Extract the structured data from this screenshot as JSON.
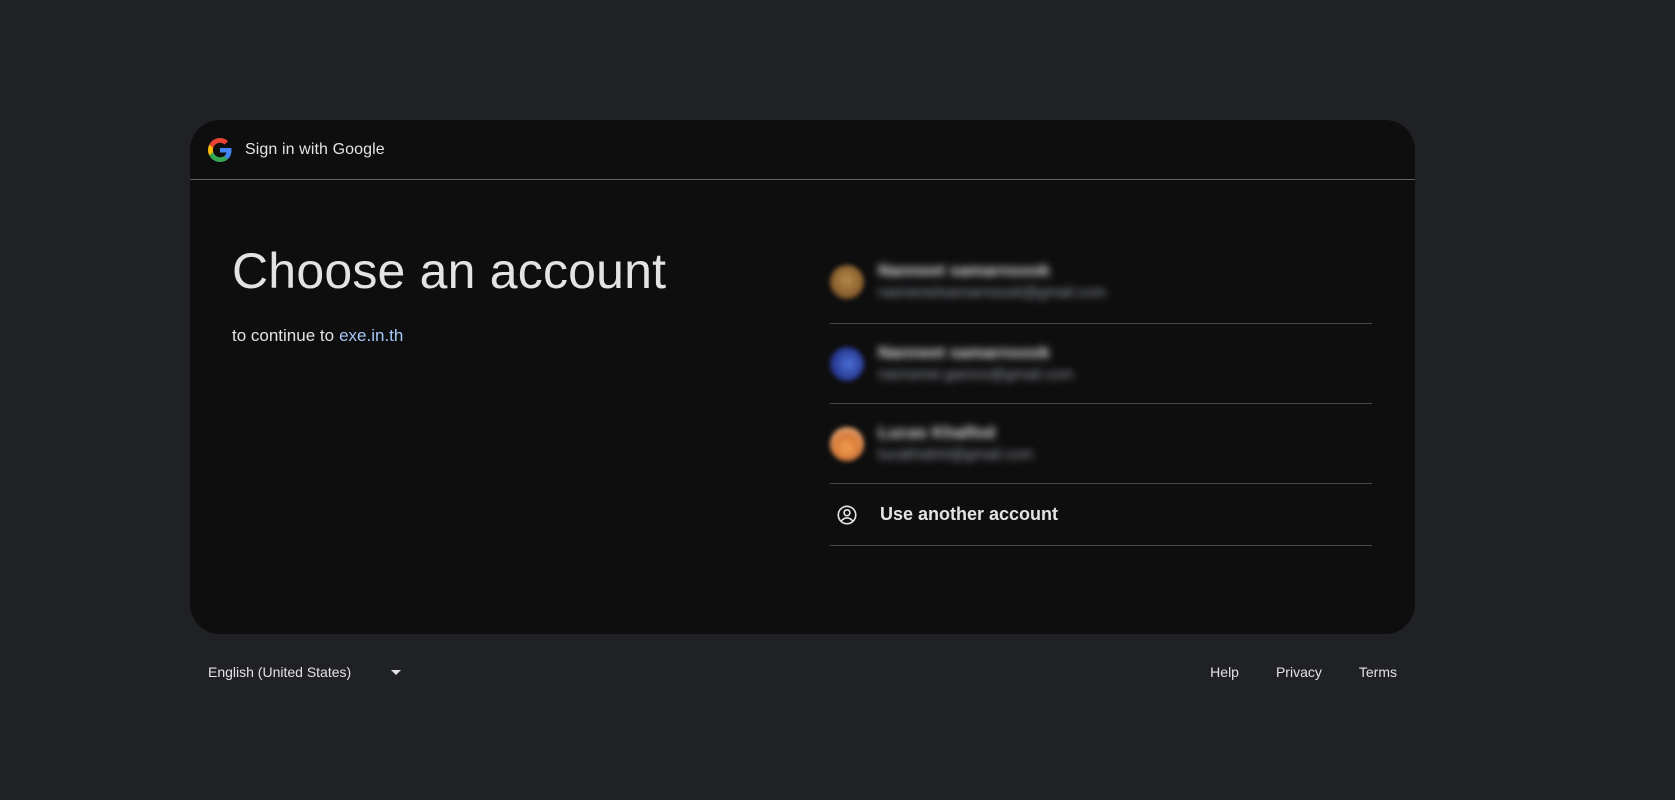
{
  "header": {
    "title": "Sign in with Google",
    "logo_icon": "google-g-icon"
  },
  "main": {
    "headline": "Choose an account",
    "subline_prefix": "to continue to",
    "site_link": "exe.in.th"
  },
  "accounts": [
    {
      "name": "Nanneet samarnsook",
      "email": "nannenetsamarnsook@gmail.com"
    },
    {
      "name": "Nanneet samarnsook",
      "email": "nannenet.gamov@gmail.com"
    },
    {
      "name": "Lucas Khalfod",
      "email": "lucakhalmt@gmail.com"
    }
  ],
  "use_another": {
    "label": "Use another account",
    "icon": "person-circle-icon"
  },
  "footer": {
    "language": "English (United States)",
    "links": [
      "Help",
      "Privacy",
      "Terms"
    ]
  },
  "colors": {
    "page_bg": "#202124",
    "card_bg": "#0e0e0f",
    "link": "#a8c7fa",
    "text": "#e3e3e3"
  }
}
